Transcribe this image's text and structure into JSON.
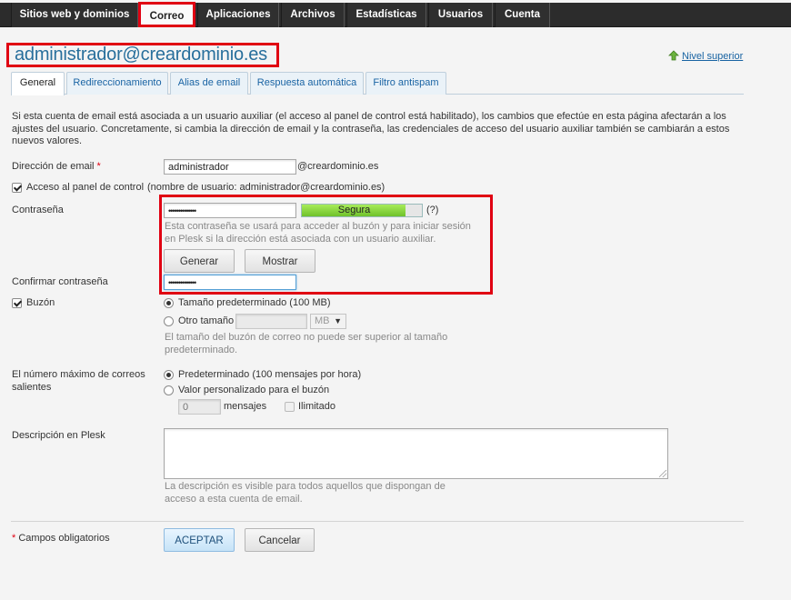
{
  "nav": {
    "tabs": [
      {
        "label": "Sitios web y dominios"
      },
      {
        "label": "Correo"
      },
      {
        "label": "Aplicaciones"
      },
      {
        "label": "Archivos"
      },
      {
        "label": "Estadísticas"
      },
      {
        "label": "Usuarios"
      },
      {
        "label": "Cuenta"
      }
    ],
    "active": "Correo"
  },
  "header": {
    "title": "administrador@creardominio.es",
    "up_link": "Nivel superior"
  },
  "tabs": [
    {
      "label": "General"
    },
    {
      "label": "Redireccionamiento"
    },
    {
      "label": "Alias de email"
    },
    {
      "label": "Respuesta automática"
    },
    {
      "label": "Filtro antispam"
    }
  ],
  "intro": "Si esta cuenta de email está asociada a un usuario auxiliar (el acceso al panel de control está habilitado), los cambios que efectúe en esta página afectarán a los ajustes del usuario. Concretamente, si cambia la dirección de email y la contraseña, las credenciales de acceso del usuario auxiliar también se cambiarán a estos nuevos valores.",
  "email": {
    "label": "Dirección de email",
    "required_mark": "*",
    "value": "administrador",
    "domain": "@creardominio.es"
  },
  "panel_access": {
    "label": "Acceso al panel de control",
    "username_note": "(nombre de usuario: administrador@creardominio.es)",
    "checked": true
  },
  "password": {
    "label": "Contraseña",
    "value": "••••••••••••••",
    "strength_label": "Segura",
    "strength_level": 0.86,
    "help": "(?)",
    "hint": "Esta contraseña se usará para acceder al buzón y para iniciar sesión en Plesk si la dirección está asociada con un usuario auxiliar.",
    "generate_label": "Generar",
    "show_label": "Mostrar"
  },
  "confirm_password": {
    "label": "Confirmar contraseña",
    "value": "••••••••••••••"
  },
  "mailbox": {
    "label": "Buzón",
    "checked": true,
    "default_size_label": "Tamaño predeterminado (100 MB)",
    "other_size_label": "Otro tamaño",
    "unit": "MB",
    "hint": "El tamaño del buzón de correo no puede ser superior al tamaño predeterminado."
  },
  "outgoing": {
    "label": "El número máximo de correos salientes",
    "default_label": "Predeterminado (100 mensajes por hora)",
    "custom_label": "Valor personalizado para el buzón",
    "custom_placeholder": "0",
    "messages_label": "mensajes",
    "unlimited_label": "Ilimitado"
  },
  "description": {
    "label": "Descripción en Plesk",
    "value": "",
    "hint": "La descripción es visible para todos aquellos que dispongan de acceso a esta cuenta de email."
  },
  "footer": {
    "required_note": "Campos obligatorios",
    "required_mark": "*",
    "ok_label": "ACEPTAR",
    "cancel_label": "Cancelar"
  },
  "colors": {
    "highlight": "#e00012",
    "link": "#1863a2",
    "title": "#286f9c",
    "strength_fill": "#7fd23a"
  }
}
